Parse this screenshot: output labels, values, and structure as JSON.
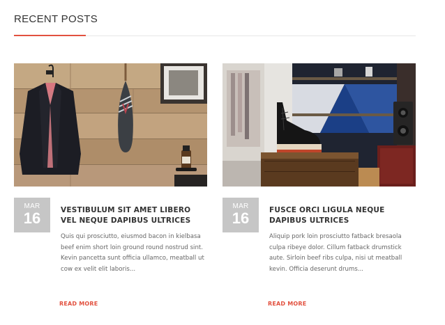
{
  "section": {
    "title": "RECENT POSTS"
  },
  "posts": [
    {
      "month": "MAR",
      "day": "16",
      "title": "VESTIBULUM SIT AMET LIBERO VEL NEQUE DAPIBUS ULTRICES",
      "excerpt": "Quis qui prosciutto, eiusmod bacon in kielbasa beef enim short loin ground round nostrud sint. Kevin pancetta sunt officia ullamco, meatball ut cow ex velit elit laboris...",
      "read_more": "READ MORE"
    },
    {
      "month": "MAR",
      "day": "16",
      "title": "FUSCE ORCI LIGULA NEQUE DAPIBUS ULTRICES",
      "excerpt": "Aliquip pork loin prosciutto fatback bresaola culpa ribeye dolor. Cillum fatback drumstick aute. Sirloin beef ribs culpa, nisi ut meatball kevin. Officia deserunt drums...",
      "read_more": "READ MORE"
    }
  ],
  "colors": {
    "accent": "#e2513f",
    "date_badge": "#c6c6c6",
    "rule": "#e6e6e6"
  }
}
